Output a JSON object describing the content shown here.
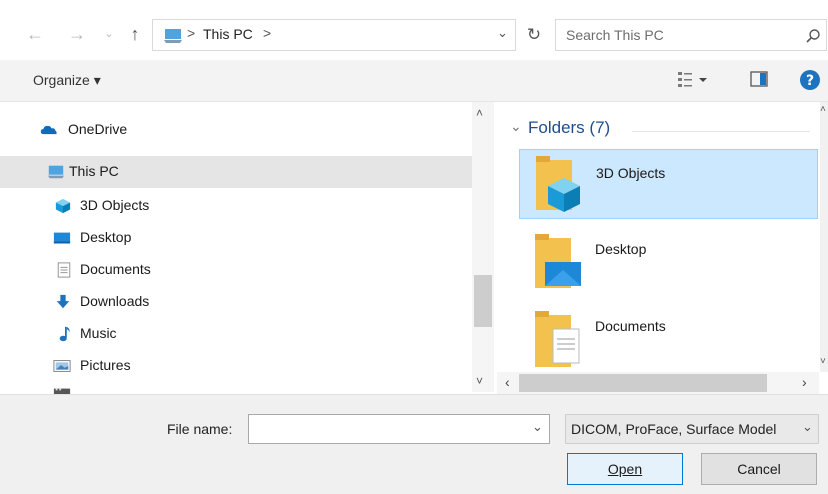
{
  "address": {
    "path": "This PC",
    "separator": ">",
    "back_icon": "arrow-left",
    "forward_icon": "arrow-right",
    "up_icon": "arrow-up",
    "refresh_icon": "refresh"
  },
  "search": {
    "placeholder": "Search This PC"
  },
  "toolbar": {
    "organize_label": "Organize ▾"
  },
  "sidebar": {
    "items": [
      {
        "label": "OneDrive",
        "icon": "cloud-icon"
      },
      {
        "label": "This PC",
        "icon": "computer-icon",
        "selected": true
      },
      {
        "label": "3D Objects",
        "icon": "cube-icon"
      },
      {
        "label": "Desktop",
        "icon": "desktop-icon"
      },
      {
        "label": "Documents",
        "icon": "document-icon"
      },
      {
        "label": "Downloads",
        "icon": "download-icon"
      },
      {
        "label": "Music",
        "icon": "music-icon"
      },
      {
        "label": "Pictures",
        "icon": "pictures-icon"
      }
    ]
  },
  "main": {
    "folders_header": "Folders (7)",
    "folders": [
      {
        "label": "3D Objects",
        "selected": true
      },
      {
        "label": "Desktop"
      },
      {
        "label": "Documents"
      }
    ]
  },
  "bottom": {
    "file_name_label": "File name:",
    "file_name_value": "",
    "file_type": "DICOM, ProFace, Surface Model",
    "open_label": "Open",
    "cancel_label": "Cancel"
  },
  "colors": {
    "selection": "#cce8ff",
    "accent": "#0078d7",
    "folder": "#f2c14e"
  }
}
